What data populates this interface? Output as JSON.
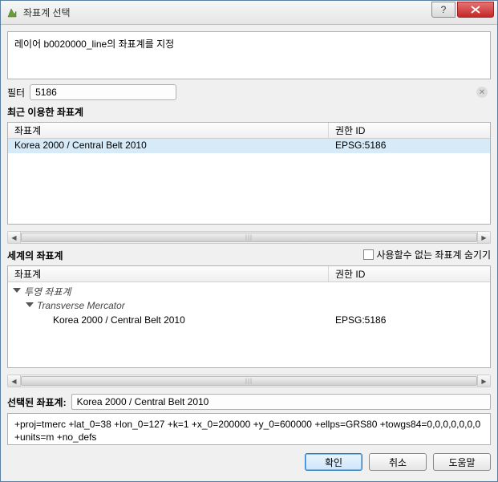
{
  "window": {
    "title": "좌표계 선택"
  },
  "info": {
    "text": "레이어 b0020000_line의 좌표계를 지정"
  },
  "filter": {
    "label": "필터",
    "value": "5186"
  },
  "recent": {
    "title": "최근 이용한 좌표계",
    "col_crs": "좌표계",
    "col_auth": "권한 ID",
    "rows": [
      {
        "name": "Korea 2000 / Central Belt 2010",
        "auth": "EPSG:5186"
      }
    ]
  },
  "world": {
    "title": "세계의 좌표계",
    "hide_label": "사용할수 없는 좌표계 숨기기",
    "col_crs": "좌표계",
    "col_auth": "권한 ID",
    "group1": "투영 좌표계",
    "group2": "Transverse Mercator",
    "item_name": "Korea 2000 / Central Belt 2010",
    "item_auth": "EPSG:5186"
  },
  "selected": {
    "label": "선택된 좌표계:",
    "value": "Korea 2000 / Central Belt 2010"
  },
  "proj": {
    "text": "+proj=tmerc +lat_0=38 +lon_0=127 +k=1 +x_0=200000 +y_0=600000 +ellps=GRS80 +towgs84=0,0,0,0,0,0,0 +units=m +no_defs"
  },
  "buttons": {
    "ok": "확인",
    "cancel": "취소",
    "help": "도움말"
  }
}
